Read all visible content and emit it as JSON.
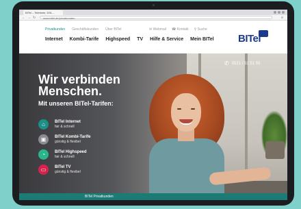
{
  "browser": {
    "tab_title": "BITel – Telefonie, DSL...",
    "url": "www.bitel.de/privatkunden",
    "back_icon": "back-arrow-icon",
    "forward_icon": "forward-arrow-icon",
    "reload_icon": "reload-icon",
    "menu_icon": "menu-icon"
  },
  "header": {
    "top_nav": [
      "Privatkunden",
      "Geschäftskunden",
      "Über BITel"
    ],
    "active_top_nav": "Privatkunden",
    "utility": [
      "Webmail",
      "Kontakt",
      "Suche"
    ],
    "main_nav": [
      "Internet",
      "Kombi-Tarife",
      "Highspeed",
      "TV",
      "Hilfe & Service",
      "Mein BITel"
    ],
    "logo_text": "BITel"
  },
  "hero": {
    "phone": "0521 / 51 51 55",
    "headline_line1": "Wir verbinden",
    "headline_line2": "Menschen.",
    "subline": "Mit unseren BITel-Tarifen:"
  },
  "products": [
    {
      "name": "BITel Internet",
      "sub": "fair & schnell",
      "icon": "house-icon",
      "color": "#1c8f86"
    },
    {
      "name": "BITel Kombi-Tarife",
      "sub": "günstig & flexibel",
      "icon": "combo-icon",
      "color": "#8a8c90"
    },
    {
      "name": "BITel Highspeed",
      "sub": "fair & schnell",
      "icon": "speed-icon",
      "color": "#2bb58a"
    },
    {
      "name": "BITel TV",
      "sub": "günstig & flexibel",
      "icon": "tv-icon",
      "color": "#d6234d"
    }
  ],
  "footer": {
    "label": "BITel Privatkunden",
    "color": "#1c7b74"
  },
  "colors": {
    "background": "#7fcfca",
    "brand_blue": "#1b3b8a",
    "accent_teal": "#1a8f87"
  }
}
